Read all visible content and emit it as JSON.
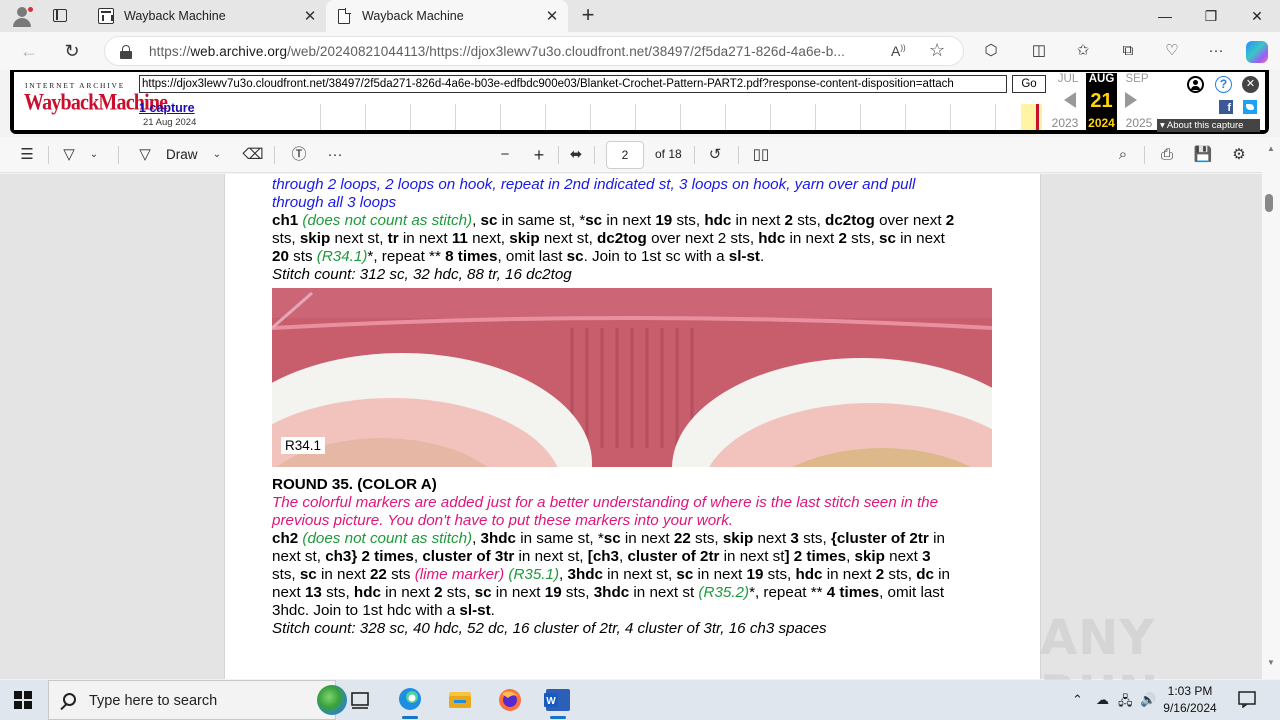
{
  "browser": {
    "tabs": [
      {
        "title": "Wayback Machine",
        "active": false
      },
      {
        "title": "Wayback Machine",
        "active": true
      }
    ],
    "url_prefix": "https://",
    "url_domain": "web.archive.org",
    "url_rest": "/web/20240821044113/https://djox3lewv7u3o.cloudfront.net/38497/2f5da271-826d-4a6e-b...",
    "icons": [
      "back-arrow-icon",
      "refresh-icon",
      "lock-icon",
      "read-aloud-icon",
      "favorite-star-icon",
      "extensions-icon",
      "split-screen-icon",
      "favorites-icon",
      "collections-icon",
      "browser-essentials-icon",
      "more-icon",
      "copilot-icon"
    ]
  },
  "wayback": {
    "logo_top": "INTERNET ARCHIVE",
    "logo_main": "WaybackMachine",
    "url_value": "https://djox3lewv7u3o.cloudfront.net/38497/2f5da271-826d-4a6e-b03e-edfbdc900e03/Blanket-Crochet-Pattern-PART2.pdf?response-content-disposition=attach",
    "go_label": "Go",
    "captures_label": "1 capture",
    "capture_date": "21 Aug 2024",
    "prev_month": "JUL",
    "current_month": "AUG",
    "next_month": "SEP",
    "current_day": "21",
    "prev_year": "2023",
    "current_year": "2024",
    "next_year": "2025",
    "about_label": "About this capture"
  },
  "pdf_toolbar": {
    "draw_label": "Draw",
    "page_number": "2",
    "page_total": "of 18"
  },
  "document": {
    "line_top_1": "through 2 loops, 2 loops on hook, repeat in 2nd indicated st, 3 loops on hook, yarn over and pull",
    "line_top_2": "through all 3 loops",
    "r34": {
      "ch1": "ch1",
      "note1": "(does not count as stitch)",
      "p1": ", ",
      "b1": "sc",
      "p2": " in same st, *",
      "b2": "sc",
      "p3": " in next ",
      "b3": "19",
      "p4": " sts, ",
      "b4": "hdc",
      "p5": " in next ",
      "b5": "2",
      "p6": " sts, ",
      "b6": "dc2tog",
      "p7": " over next ",
      "b7": "2",
      "l2p1": "sts, ",
      "l2b1": "skip",
      "l2p2": " next st, ",
      "l2b2": "tr",
      "l2p3": " in next ",
      "l2b3": "11",
      "l2p4": " next, ",
      "l2b4": "skip",
      "l2p5": " next st, ",
      "l2b5": "dc2tog",
      "l2p6": " over next 2 sts, ",
      "l2b6": "hdc",
      "l2p7": " in next ",
      "l2b7": "2",
      "l2p8": " sts, ",
      "l2b8": "sc",
      "l2p9": " in next",
      "l3b1": "20",
      "l3p1": " sts ",
      "l3g1": "(R34.1)",
      "l3p2": "*, repeat ** ",
      "l3b2": "8 times",
      "l3p3": ", omit last ",
      "l3b3": "sc",
      "l3p4": ". Join to 1st sc with a ",
      "l3b4": "sl-st",
      "l3p5": ".",
      "stitch_count": "Stitch count: 312 sc, 32 hdc, 88 tr, 16 dc2tog"
    },
    "photo_label": "R34.1",
    "r35_heading": "ROUND 35. (COLOR A)",
    "r35_note_1": "The colorful markers are added just for a better understanding of where is the last stitch seen in the",
    "r35_note_2": "previous picture. You don't have to put these markers into your work.",
    "r35": {
      "ch2": "ch2",
      "note1": "(does not count as stitch)",
      "p1": ", ",
      "b1": "3hdc",
      "p2": " in same st, *",
      "b2": "sc",
      "p3": " in next ",
      "b3": "22",
      "p4": " sts, ",
      "b4": "skip",
      "p5": " next ",
      "b5": "3",
      "p6": " sts, ",
      "b6": "{cluster of 2tr",
      "p7": " in",
      "l2p1": "next st, ",
      "l2b1": "ch3}",
      "l2p2": " ",
      "l2b2": "2 times",
      "l2p3": ", ",
      "l2b3": "cluster of 3tr",
      "l2p4": " in next st, ",
      "l2b4": "[ch3",
      "l2p5": ", ",
      "l2b5": "cluster of 2tr",
      "l2p6": " in next st",
      "l2b6": "] 2 times",
      "l2p7": ", ",
      "l2b7": "skip",
      "l2p8": " next ",
      "l2b8": "3",
      "l3p1": "sts, ",
      "l3b1": "sc",
      "l3p2": " in next ",
      "l3b2": "22",
      "l3p3": " sts ",
      "l3m1": "(lime marker)",
      "l3p4": " ",
      "l3g1": "(R35.1)",
      "l3p5": ", ",
      "l3b3": "3hdc",
      "l3p6": " in next st, ",
      "l3b4": "sc",
      "l3p7": " in next ",
      "l3b5": "19",
      "l3p8": " sts, ",
      "l3b6": "hdc",
      "l3p9": " in next ",
      "l3b7": "2",
      "l3p10": " sts, ",
      "l3b8": "dc",
      "l3p11": " in",
      "l4p1": "next ",
      "l4b1": "13",
      "l4p2": " sts, ",
      "l4b2": "hdc",
      "l4p3": " in next ",
      "l4b3": "2",
      "l4p4": " sts, ",
      "l4b4": "sc",
      "l4p5": " in next ",
      "l4b5": "19",
      "l4p6": " sts, ",
      "l4b6": "3hdc",
      "l4p7": " in next st ",
      "l4g1": "(R35.2)",
      "l4p8": "*, repeat ** ",
      "l4b7": "4 times",
      "l4p9": ", omit last",
      "l5p1": "3hdc. Join to 1st hdc with a ",
      "l5b1": "sl-st",
      "l5p2": ".",
      "stitch_count": "Stitch count: 328 sc, 40 hdc, 52 dc, 16 cluster of 2tr, 4 cluster of 3tr, 16 ch3 spaces"
    }
  },
  "taskbar": {
    "search_placeholder": "Type here to search",
    "time": "1:03 PM",
    "date": "9/16/2024",
    "apps": [
      "task-view-icon",
      "edge-icon",
      "file-explorer-icon",
      "firefox-icon",
      "word-icon"
    ]
  },
  "watermark": "ANY RUN"
}
